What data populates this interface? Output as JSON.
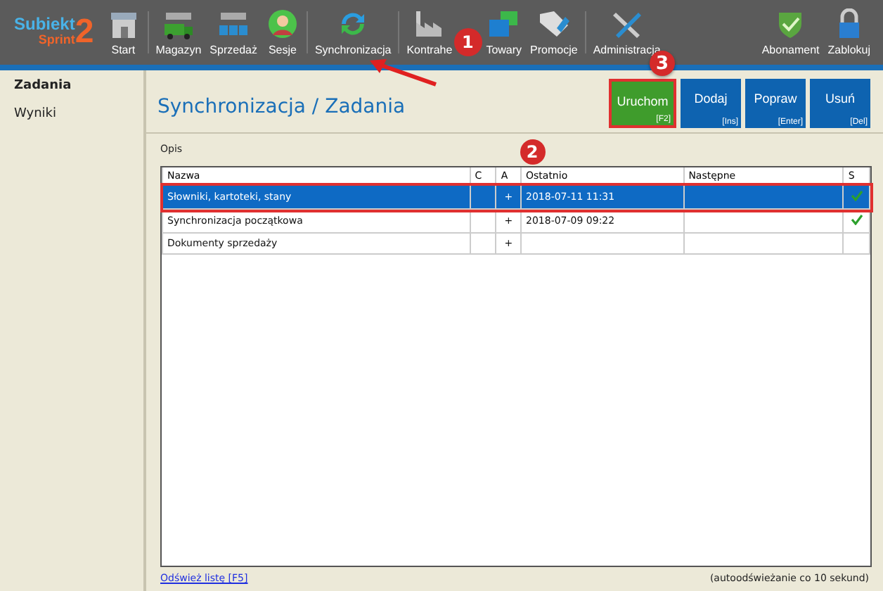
{
  "logo": {
    "name": "Subiekt",
    "sub": "Sprint",
    "num": "2"
  },
  "toolbar": [
    "Start",
    "Magazyn",
    "Sprzedaż",
    "Sesje",
    "Synchronizacja",
    "Kontrahe",
    "Towary",
    "Promocje",
    "Administracja"
  ],
  "toolbar_right": [
    "Abonament",
    "Zablokuj"
  ],
  "sidebar": [
    {
      "label": "Zadania",
      "selected": true
    },
    {
      "label": "Wyniki",
      "selected": false
    }
  ],
  "title": "Synchronizacja / Zadania",
  "actions": [
    {
      "label": "Uruchom",
      "key": "[F2]",
      "kind": "primary"
    },
    {
      "label": "Dodaj",
      "key": "[Ins]",
      "kind": "normal"
    },
    {
      "label": "Popraw",
      "key": "[Enter]",
      "kind": "normal"
    },
    {
      "label": "Usuń",
      "key": "[Del]",
      "kind": "normal"
    }
  ],
  "section_label": "Opis",
  "table": {
    "columns": [
      "Nazwa",
      "C",
      "A",
      "Ostatnio",
      "Następne",
      "S"
    ],
    "rows": [
      {
        "cells": [
          "Słowniki, kartoteki, stany",
          "",
          "+",
          "2018-07-11 11:31",
          ""
        ],
        "ok": true,
        "selected": true
      },
      {
        "cells": [
          "Synchronizacja początkowa",
          "",
          "+",
          "2018-07-09 09:22",
          ""
        ],
        "ok": true,
        "selected": false
      },
      {
        "cells": [
          "Dokumenty sprzedaży",
          "",
          "+",
          "",
          ""
        ],
        "ok": false,
        "selected": false
      }
    ]
  },
  "refresh_link": "Odśwież listę [F5]",
  "auto_note": "(autoodświeżanie co 10 sekund)",
  "callouts": [
    "1",
    "2",
    "3"
  ]
}
